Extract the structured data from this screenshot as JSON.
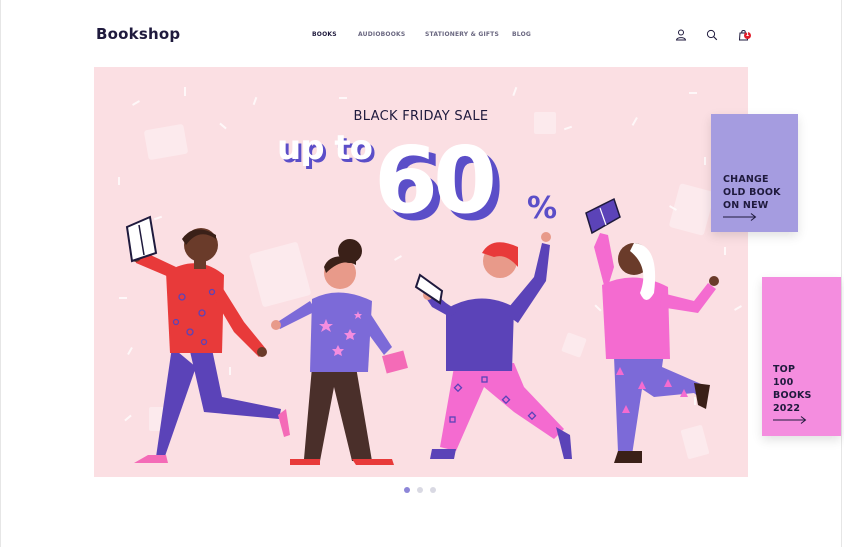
{
  "header": {
    "logo": "Bookshop",
    "nav": [
      {
        "label": "BOOKS",
        "active": true
      },
      {
        "label": "AUDIOBOOKS",
        "active": false
      },
      {
        "label": "STATIONERY & GIFTS",
        "active": false
      },
      {
        "label": "BLOG",
        "active": false
      }
    ],
    "icons": [
      "user-icon",
      "search-icon",
      "cart-icon"
    ],
    "cart_count": "1"
  },
  "hero": {
    "title": "BLACK FRIDAY SALE",
    "prefix": "up to",
    "discount": "60",
    "unit": "%",
    "background": "#fbdfe3"
  },
  "promos": {
    "change": {
      "text": "CHANGE\nOLD BOOK\nON NEW",
      "color": "#a59ce0"
    },
    "top": {
      "text": "TOP\n100\nBOOKS\n2022",
      "color": "#f48ddf"
    }
  },
  "carousel": {
    "slides": 3,
    "active_index": 0
  },
  "colors": {
    "accent": "#5b4ec8",
    "text_dark": "#1f1a3d",
    "badge": "#e11d2a"
  }
}
